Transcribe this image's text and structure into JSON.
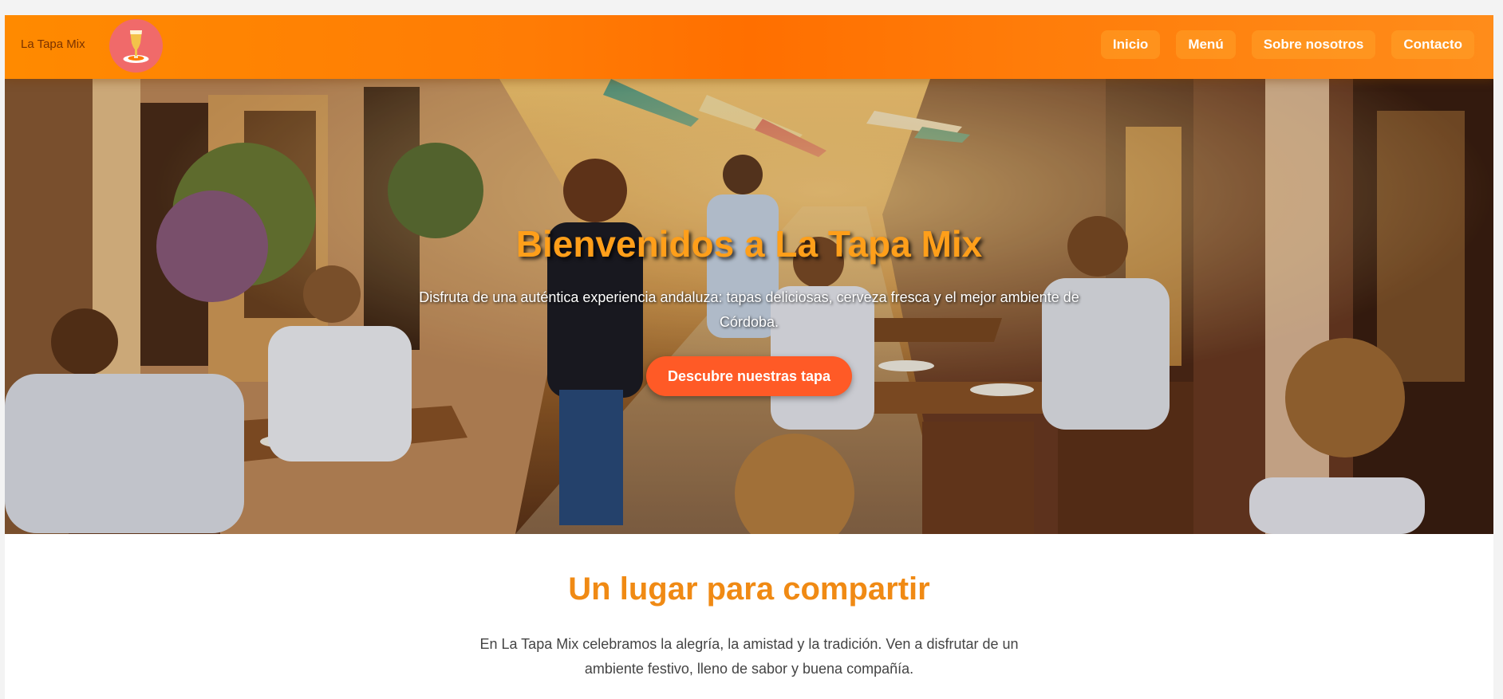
{
  "header": {
    "brand": "La Tapa Mix",
    "logo_icon": "beer-glass-icon",
    "nav": [
      {
        "label": "Inicio"
      },
      {
        "label": "Menú"
      },
      {
        "label": "Sobre nosotros"
      },
      {
        "label": "Contacto"
      }
    ]
  },
  "hero": {
    "title": "Bienvenidos a La Tapa Mix",
    "subtitle": "Disfruta de una auténtica experiencia andaluza: tapas deliciosas, cerveza fresca y el mejor ambiente de Córdoba.",
    "cta_label": "Descubre nuestras tapa"
  },
  "intro": {
    "title": "Un lugar para compartir",
    "text": "En La Tapa Mix celebramos la alegría, la amistad y la tradición. Ven a disfrutar de un ambiente festivo, lleno de sabor y buena compañía."
  },
  "colors": {
    "header_orange": "#ff7a00",
    "accent_title": "#f08a14",
    "cta": "#ff5a26",
    "logo_bg": "#f06a6a"
  }
}
